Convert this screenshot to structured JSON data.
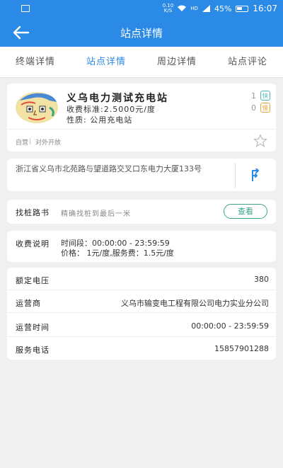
{
  "status_bar": {
    "network": "HD",
    "battery": "45%",
    "time": "16:07",
    "net_top": "0.10",
    "net_bottom": "K/S"
  },
  "header": {
    "title": "站点详情"
  },
  "tabs": [
    {
      "label": "终端详情",
      "active": false
    },
    {
      "label": "站点详情",
      "active": true
    },
    {
      "label": "周边详情",
      "active": false
    },
    {
      "label": "站点评论",
      "active": false
    }
  ],
  "station": {
    "name": "义乌电力测试充电站",
    "fee_standard": "收费标准:2.5000元/度",
    "type": "性质: 公用充电站",
    "fast_count": "1",
    "slow_count": "0",
    "fast_label": "快",
    "slow_label": "慢",
    "tags": [
      "自营",
      "对外开放"
    ]
  },
  "address": {
    "text": "浙江省义乌市北苑路与望道路交叉口东电力大厦133号"
  },
  "guide": {
    "label": "找桩路书",
    "text": "精确找桩到最后一米",
    "button": "查看"
  },
  "fee_desc": {
    "label": "收费说明",
    "time_range": "时间段：00:00:00 - 23:59:59",
    "price": "价格： 1元/度,服务费：1.5元/度"
  },
  "info": [
    {
      "key": "额定电压",
      "value": "380"
    },
    {
      "key": "运营商",
      "value": "义乌市输变电工程有限公司电力实业分公司"
    },
    {
      "key": "运营时间",
      "value": "00:00:00 - 23:59:59"
    },
    {
      "key": "服务电话",
      "value": "15857901288"
    }
  ],
  "colors": {
    "primary": "#2a8ae6",
    "accent_green": "#3aa38a",
    "fast": "#4cb6b6",
    "slow": "#e7a53c"
  }
}
